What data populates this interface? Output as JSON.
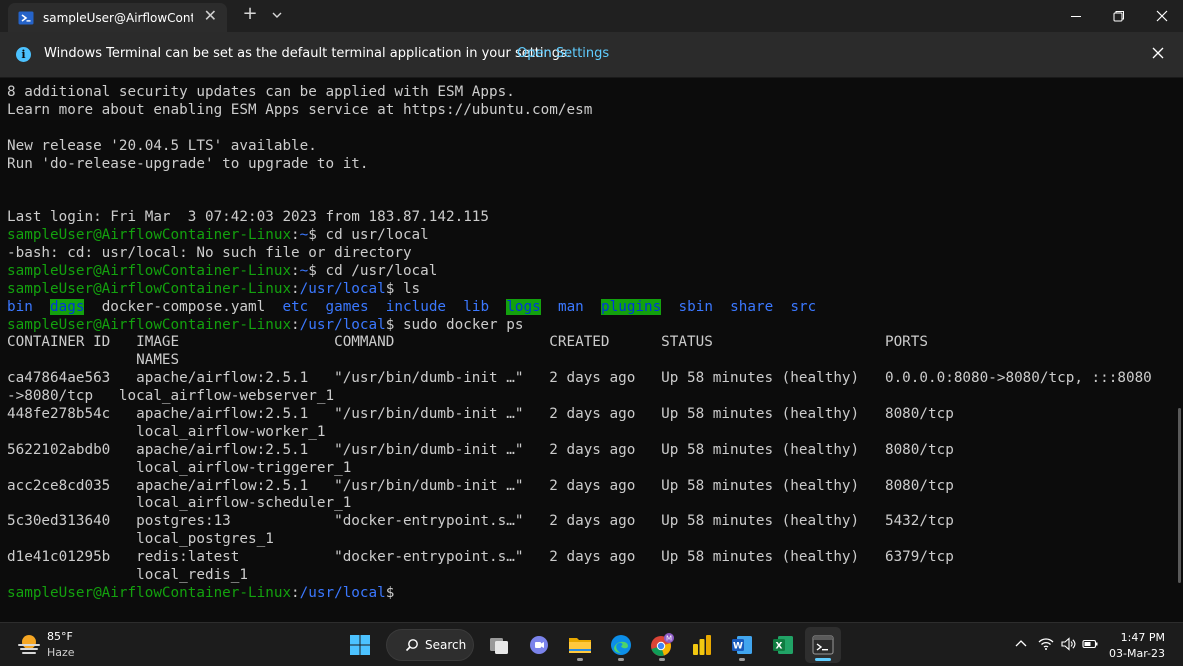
{
  "window": {
    "tab_title": "sampleUser@AirflowContaine",
    "new_tab_label": "+",
    "colors": {
      "titlebar": "#202020",
      "tab": "#2c2c2c",
      "terminal_bg": "#0c0c0c"
    }
  },
  "infobar": {
    "message": "Windows Terminal can be set as the default terminal application in your settings.",
    "link": "Open Settings"
  },
  "terminal": {
    "colors": {
      "text": "#cccccc",
      "prompt_user": "#13a10e",
      "path_and_dirs": "#3b78ff",
      "dir_highlight_bg": "#13a10e"
    },
    "motd_1": "8 additional security updates can be applied with ESM Apps.",
    "motd_2": "Learn more about enabling ESM Apps service at https://ubuntu.com/esm",
    "release_1": "New release '20.04.5 LTS' available.",
    "release_2": "Run 'do-release-upgrade' to upgrade to it.",
    "last_login": "Last login: Fri Mar  3 07:42:03 2023 from 183.87.142.115",
    "prompt_user": "sampleUser@AirflowContainer-Linux",
    "prompt_colon": ":",
    "home_path": "~",
    "local_path": "/usr/local",
    "prompt_dollar": "$ ",
    "cmd1": "cd usr/local",
    "cmd1_error": "-bash: cd: usr/local: No such file or directory",
    "cmd2": "cd /usr/local",
    "cmd3": "ls",
    "ls_items": [
      "bin",
      "dags",
      "docker-compose.yaml",
      "etc",
      "games",
      "include",
      "lib",
      "logs",
      "man",
      "plugins",
      "sbin",
      "share",
      "src"
    ],
    "cmd4": "sudo docker ps",
    "docker_header_1": "CONTAINER ID   IMAGE                  COMMAND                  CREATED      STATUS                    PORTS",
    "docker_header_2": "               NAMES",
    "docker_rows": [
      "ca47864ae563   apache/airflow:2.5.1   \"/usr/bin/dumb-init …\"   2 days ago   Up 58 minutes (healthy)   0.0.0.0:8080->8080/tcp, :::8080",
      "->8080/tcp   local_airflow-webserver_1",
      "448fe278b54c   apache/airflow:2.5.1   \"/usr/bin/dumb-init …\"   2 days ago   Up 58 minutes (healthy)   8080/tcp",
      "               local_airflow-worker_1",
      "5622102abdb0   apache/airflow:2.5.1   \"/usr/bin/dumb-init …\"   2 days ago   Up 58 minutes (healthy)   8080/tcp",
      "               local_airflow-triggerer_1",
      "acc2ce8cd035   apache/airflow:2.5.1   \"/usr/bin/dumb-init …\"   2 days ago   Up 58 minutes (healthy)   8080/tcp",
      "               local_airflow-scheduler_1",
      "5c30ed313640   postgres:13            \"docker-entrypoint.s…\"   2 days ago   Up 58 minutes (healthy)   5432/tcp",
      "               local_postgres_1",
      "d1e41c01295b   redis:latest           \"docker-entrypoint.s…\"   2 days ago   Up 58 minutes (healthy)   6379/tcp",
      "               local_redis_1"
    ]
  },
  "taskbar": {
    "weather_temp": "85°F",
    "weather_desc": "Haze",
    "search_label": "Search",
    "apps": [
      "start-icon",
      "search",
      "task-view-icon",
      "teams-chat-icon",
      "file-explorer-icon",
      "edge-icon",
      "chrome-icon",
      "power-bi-icon",
      "word-icon",
      "excel-icon",
      "terminal-icon"
    ],
    "clock_time": "1:47 PM",
    "clock_date": "03-Mar-23"
  }
}
